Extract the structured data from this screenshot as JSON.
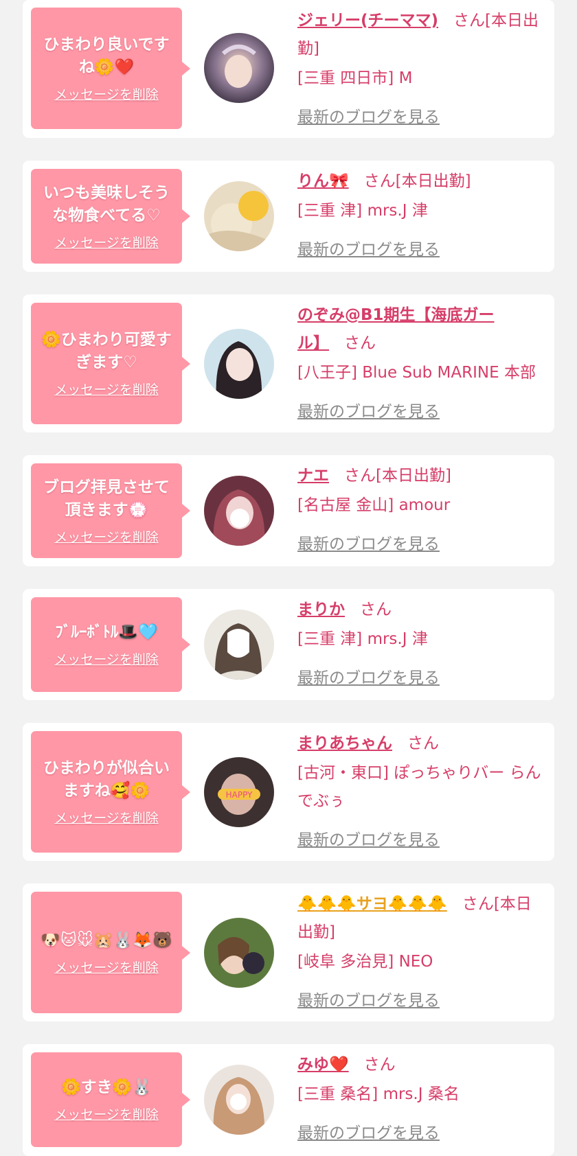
{
  "delete_label": "メッセージを削除",
  "blog_label": "最新のブログを見る",
  "colors": {
    "accent": "#d63d68",
    "bubble": "#ff97a6",
    "link_gray": "#8a8a8a",
    "background": "#f2f2f2"
  },
  "messages": [
    {
      "message_text": "ひまわり良いですね🌼❤️",
      "name": "ジェリー(チーママ)",
      "suffix": "さん[本日出勤]",
      "shop": "[三重 四日市] M"
    },
    {
      "message_text": "いつも美味しそうな物食べてる♡",
      "name": "りん🎀",
      "suffix": "さん[本日出勤]",
      "shop": "[三重 津] mrs.J 津"
    },
    {
      "message_text": "🌼ひまわり可愛すぎます♡",
      "name": "のぞみ@B1期生【海底ガール】",
      "suffix": "さん",
      "shop": "[八王子] Blue Sub MARINE 本部"
    },
    {
      "message_text": "ブログ拝見させて頂きます💮",
      "name": "ナエ",
      "suffix": "さん[本日出勤]",
      "shop": "[名古屋 金山] amour"
    },
    {
      "message_text": "ﾌﾞﾙｰﾎﾞﾄﾙ🎩🩵",
      "name": "まりか",
      "suffix": "さん",
      "shop": "[三重 津] mrs.J 津"
    },
    {
      "message_text": "ひまわりが似合いますね🥰🌼",
      "name": "まりあちゃん",
      "suffix": "さん",
      "shop": "[古河・東口] ぽっちゃりバー らんでぶぅ"
    },
    {
      "message_text": "🐶🐱🐭🐹🐰🦊🐻",
      "name": "🐥🐥🐥サヨ🐥🐥🐥",
      "suffix": "さん[本日出勤]",
      "shop": "[岐阜 多治見] NEO"
    },
    {
      "message_text": "🌼すき🌼🐰",
      "name": "みゆ❤️",
      "suffix": "さん",
      "shop": "[三重 桑名] mrs.J 桑名"
    }
  ]
}
